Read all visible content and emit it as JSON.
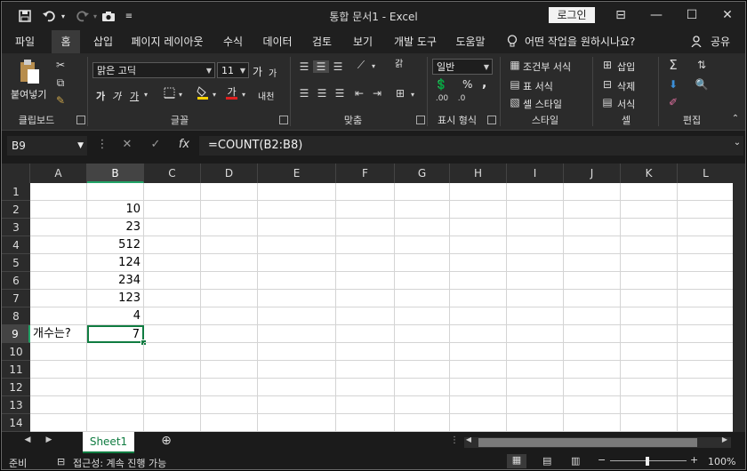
{
  "app": {
    "title": "통합 문서1  -  Excel",
    "login_label": "로그인"
  },
  "window_controls": {
    "minimize": "—",
    "maximize": "☐",
    "close": "✕",
    "ribbon_display": "⊟"
  },
  "qat": {
    "save_icon": "save-icon",
    "undo_icon": "undo-icon",
    "redo_icon": "redo-icon",
    "camera_icon": "camera-icon",
    "customize_icon": "customize-qat-icon"
  },
  "tabs": [
    {
      "label": "파일",
      "active": false
    },
    {
      "label": "홈",
      "active": true
    },
    {
      "label": "삽입",
      "active": false
    },
    {
      "label": "페이지 레이아웃",
      "active": false
    },
    {
      "label": "수식",
      "active": false
    },
    {
      "label": "데이터",
      "active": false
    },
    {
      "label": "검토",
      "active": false
    },
    {
      "label": "보기",
      "active": false
    },
    {
      "label": "개발 도구",
      "active": false
    },
    {
      "label": "도움말",
      "active": false
    }
  ],
  "tell_me": "어떤 작업을 원하시나요?",
  "share_label": "공유",
  "ribbon": {
    "clipboard": {
      "paste_label": "붙여넣기",
      "group_label": "클립보드"
    },
    "font": {
      "font_name": "맑은 고딕",
      "font_size": "11",
      "bold": "가",
      "italic": "가",
      "underline": "가",
      "grow": "가",
      "shrink": "가",
      "font_color": "가",
      "phonetic": "내천",
      "group_label": "글꼴"
    },
    "alignment": {
      "wrap": "갉",
      "group_label": "맞춤"
    },
    "number": {
      "format": "일반",
      "percent": "%",
      "comma": ",",
      "group_label": "표시 형식"
    },
    "styles": {
      "conditional": "조건부 서식",
      "table": "표 서식",
      "cell_styles": "셀 스타일",
      "group_label": "스타일"
    },
    "cells": {
      "insert": "삽입",
      "delete": "삭제",
      "format": "서식",
      "group_label": "셀"
    },
    "editing": {
      "group_label": "편집"
    }
  },
  "formula_bar": {
    "name_box": "B9",
    "formula": "=COUNT(B2:B8)",
    "fx": "fx",
    "cancel": "✕",
    "enter": "✓"
  },
  "grid": {
    "columns": [
      "A",
      "B",
      "C",
      "D",
      "E",
      "F",
      "G",
      "H",
      "I",
      "J",
      "K",
      "L"
    ],
    "rows": [
      "1",
      "2",
      "3",
      "4",
      "5",
      "6",
      "7",
      "8",
      "9",
      "10",
      "11",
      "12",
      "13",
      "14"
    ],
    "cells": {
      "B2": "10",
      "B3": "23",
      "B4": "512",
      "B5": "124",
      "B6": "234",
      "B7": "123",
      "B8": "4",
      "A9": "개수는?",
      "B9": "7"
    },
    "selected_cell": "B9"
  },
  "sheets": {
    "tabs": [
      "Sheet1"
    ],
    "add_icon": "add-sheet-icon"
  },
  "status": {
    "ready": "준비",
    "accessibility": "접근성: 계속 진행 가능",
    "zoom": "100%"
  }
}
